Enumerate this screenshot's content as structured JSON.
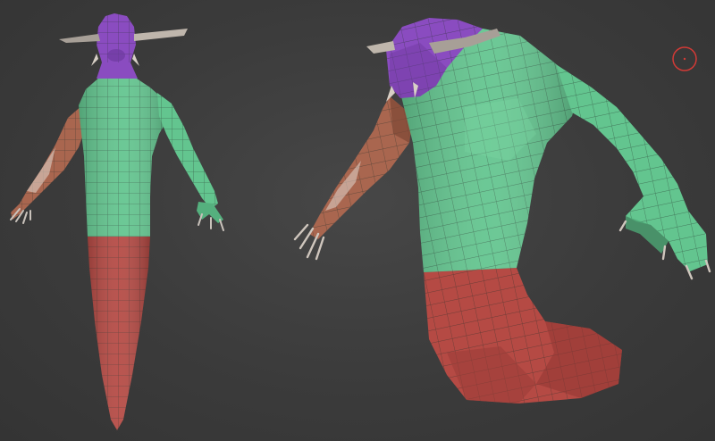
{
  "viewport": {
    "background": "#3a3a3a",
    "colors": {
      "head_purple": "#8a4cc0",
      "torso_green": "#63c58f",
      "arm_brown": "#a9664f",
      "lower_red": "#b54a44",
      "horn_gray": "#bfb6ac",
      "wire": "#2f3a34",
      "cursor_red": "#d23a36"
    },
    "models": [
      {
        "name": "model-front-view",
        "part_icons": [
          "head-mesh",
          "torso-mesh",
          "arm-mesh",
          "tail-mesh",
          "horn-mesh",
          "claw-mesh"
        ]
      },
      {
        "name": "model-three-quarter-view",
        "part_icons": [
          "head-mesh",
          "torso-mesh",
          "arm-mesh",
          "tail-mesh",
          "horn-mesh",
          "claw-mesh"
        ]
      }
    ],
    "cursor_icon": "brush-circle-icon"
  }
}
